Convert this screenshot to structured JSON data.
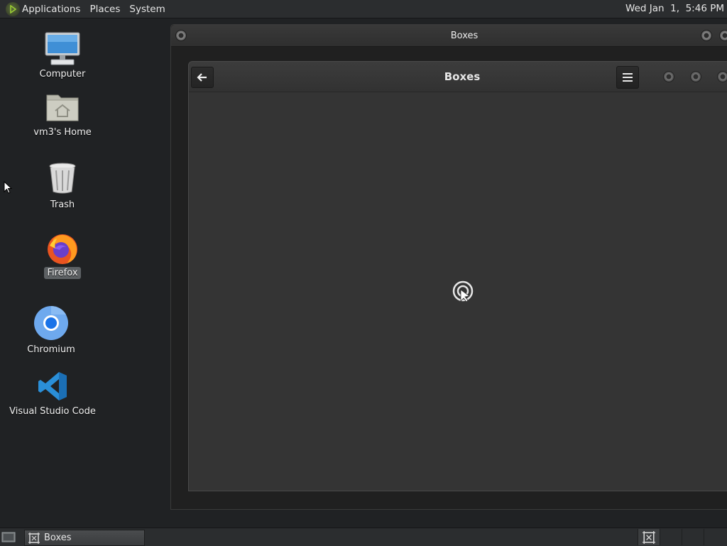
{
  "top_panel": {
    "menus": [
      "Applications",
      "Places",
      "System"
    ],
    "clock": "Wed Jan  1,  5:46 PM"
  },
  "desktop": {
    "icons": [
      {
        "label": "Computer",
        "icon": "computer-icon"
      },
      {
        "label": "vm3's Home",
        "icon": "home-folder-icon"
      },
      {
        "label": "Trash",
        "icon": "trash-icon"
      },
      {
        "label": "Firefox",
        "icon": "firefox-icon",
        "selected": true
      },
      {
        "label": "Chromium",
        "icon": "chromium-icon"
      },
      {
        "label": "Visual Studio Code",
        "icon": "vscode-icon"
      }
    ]
  },
  "outer_window": {
    "title": "Boxes"
  },
  "app_window": {
    "title": "Boxes",
    "back_icon": "back-arrow-icon",
    "menu_icon": "hamburger-menu-icon",
    "loading_icon": "loading-spinner-icon"
  },
  "bottom_panel": {
    "tasks": [
      {
        "label": "Boxes",
        "icon": "boxes-icon"
      }
    ],
    "workspace_count": 4,
    "active_workspace": 1
  },
  "colors": {
    "desktop_bg": "#202224",
    "panel_bg": "#2b2d2f",
    "window_bg": "#343434",
    "accent_vscode": "#2a8fd8"
  }
}
